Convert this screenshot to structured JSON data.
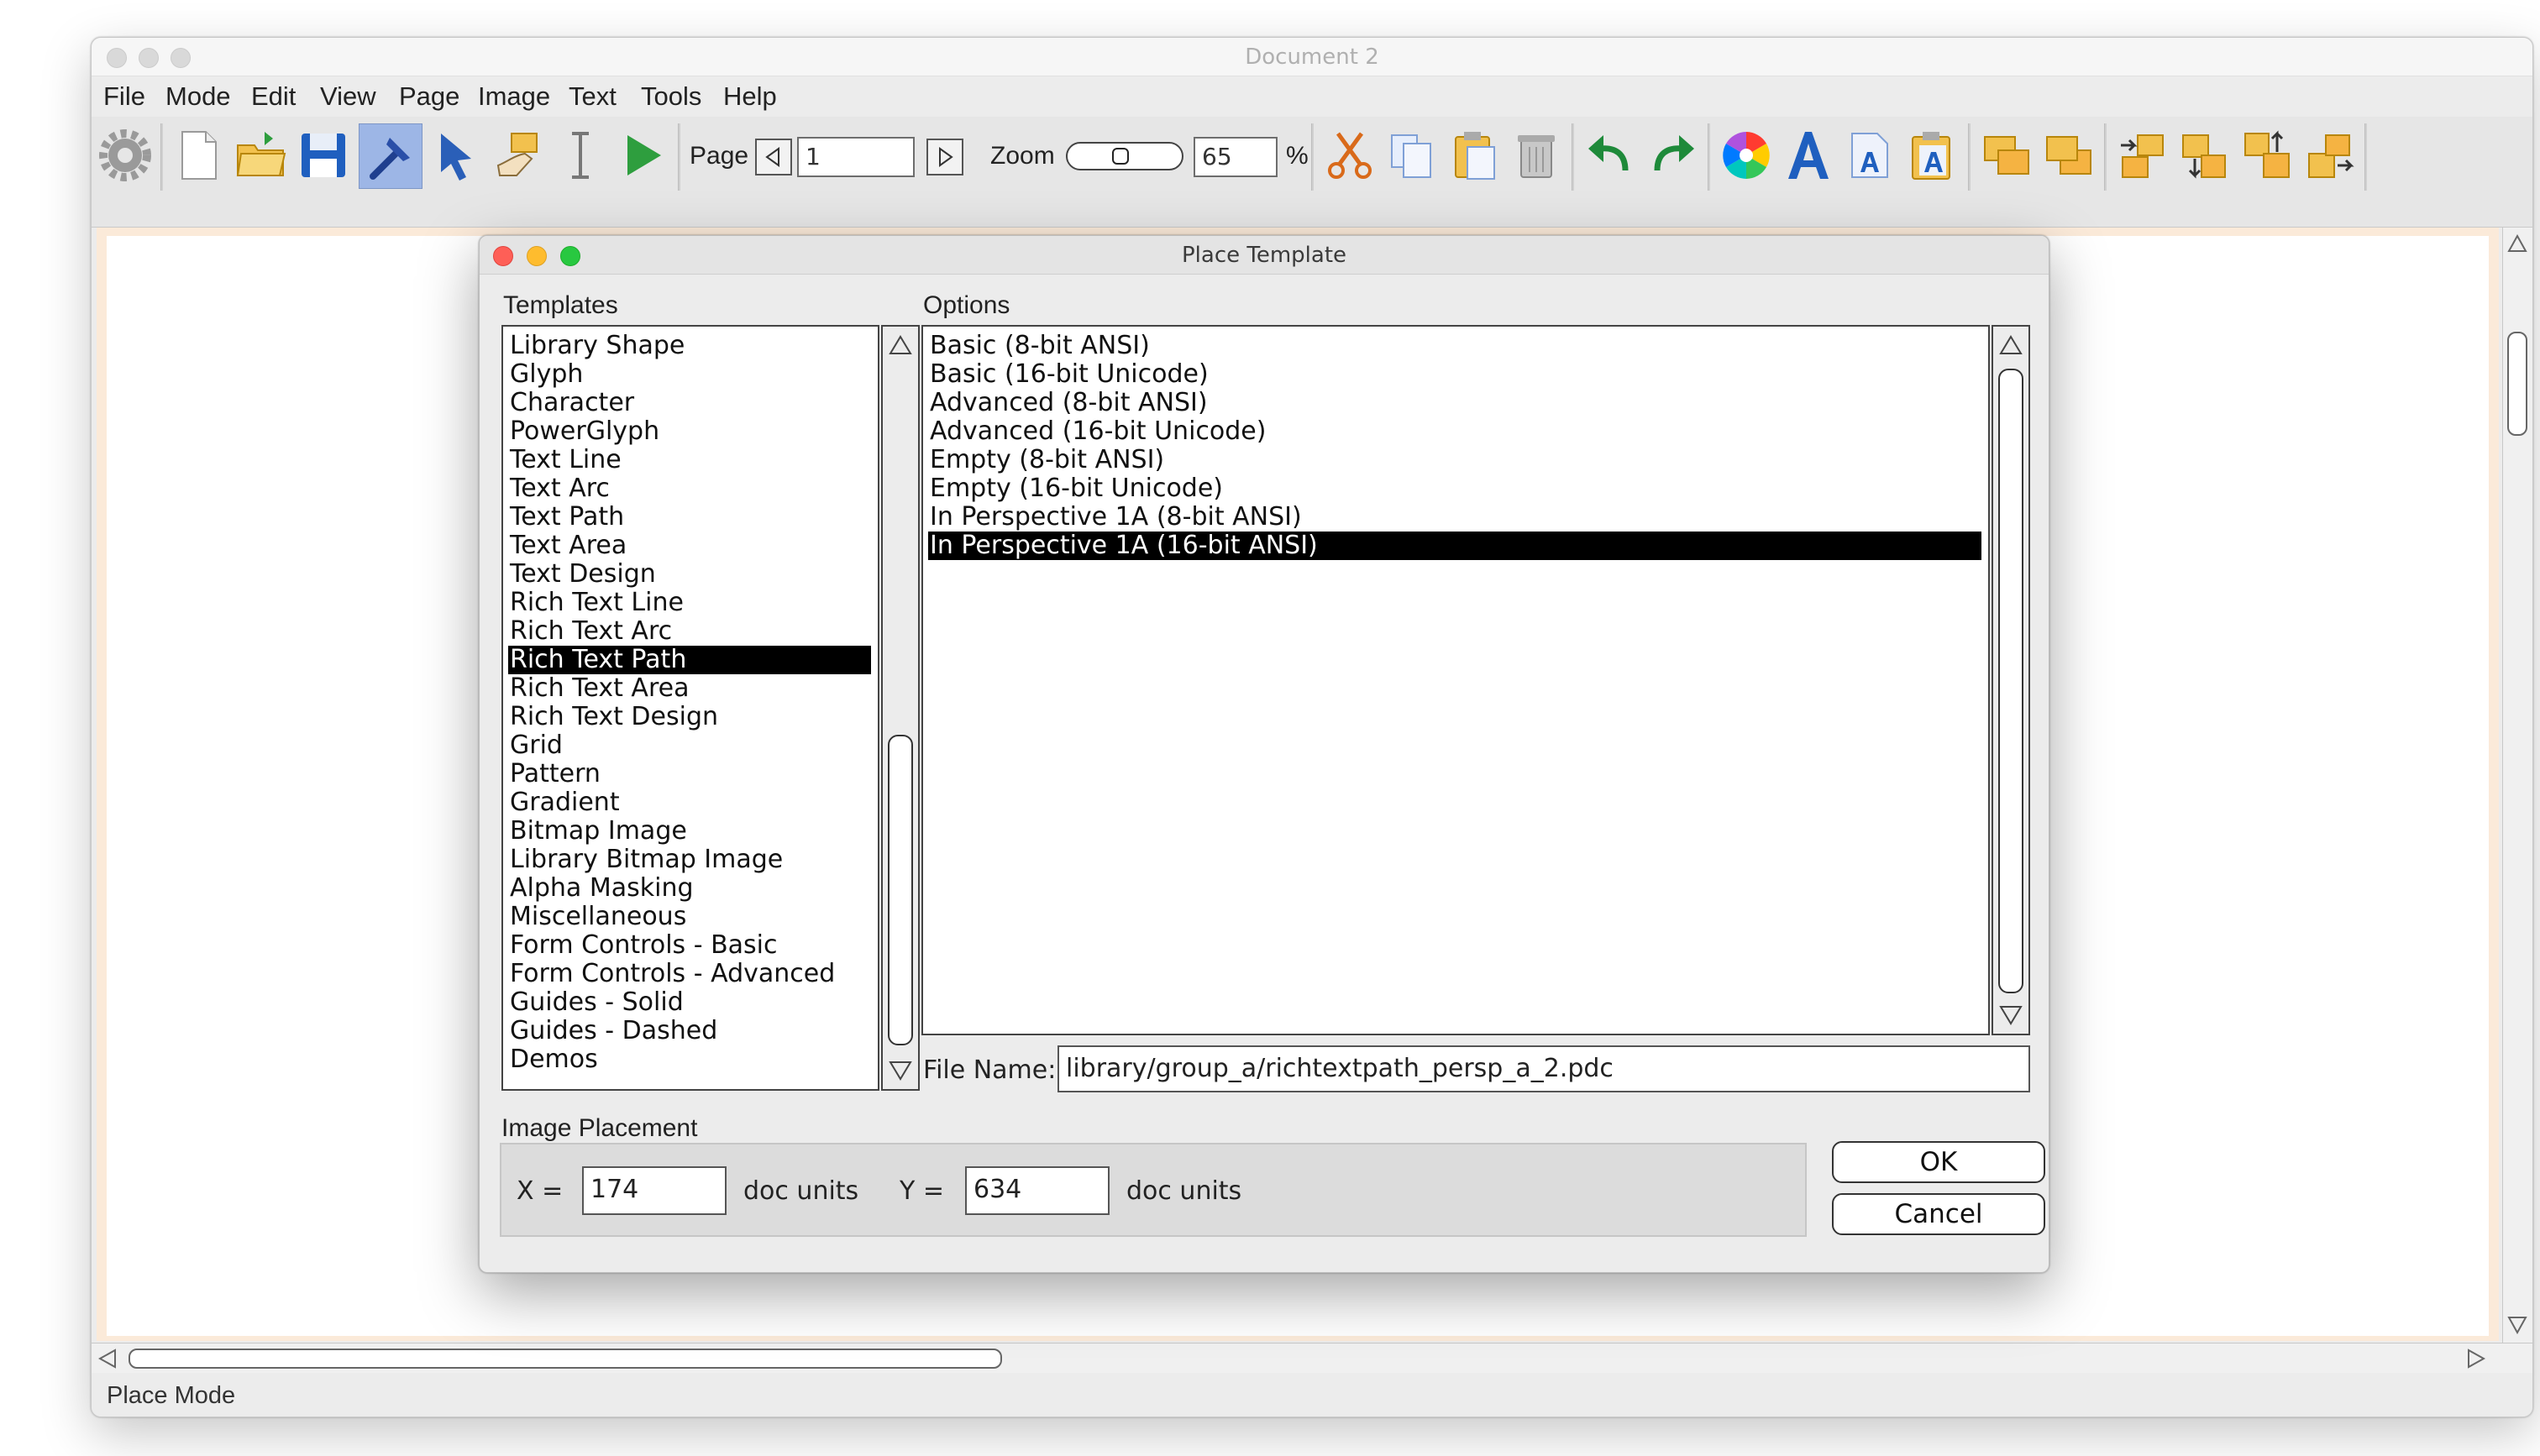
{
  "window": {
    "title": "Document 2"
  },
  "menubar": [
    "File",
    "Mode",
    "Edit",
    "View",
    "Page",
    "Image",
    "Text",
    "Tools",
    "Help"
  ],
  "toolbar": {
    "page_label": "Page",
    "page_value": "1",
    "zoom_label": "Zoom",
    "zoom_value": "65",
    "zoom_unit": "%",
    "zoom_slider_level": 0.45,
    "icons": [
      "settings-gear-icon",
      "new-document-icon",
      "open-folder-icon",
      "save-disk-icon",
      "hammer-tool-icon",
      "select-arrow-icon",
      "place-hand-icon",
      "text-cursor-icon",
      "play-icon",
      "cut-scissors-icon",
      "copy-icon",
      "paste-icon",
      "trash-icon",
      "undo-icon",
      "redo-icon",
      "color-wheel-icon",
      "font-icon",
      "text-document-icon",
      "text-clipboard-icon",
      "bring-forward-icon",
      "send-backward-icon",
      "align-left-icon",
      "align-bottom-icon",
      "align-top-icon",
      "align-right-icon"
    ]
  },
  "status": {
    "text": "Place Mode"
  },
  "dialog": {
    "title": "Place Template",
    "templates_label": "Templates",
    "options_label": "Options",
    "templates": [
      "Library Shape",
      "Glyph",
      "Character",
      "PowerGlyph",
      "Text Line",
      "Text Arc",
      "Text Path",
      "Text Area",
      "Text Design",
      "Rich Text Line",
      "Rich Text Arc",
      "Rich Text Path",
      "Rich Text Area",
      "Rich Text Design",
      "Grid",
      "Pattern",
      "Gradient",
      "Bitmap Image",
      "Library Bitmap Image",
      "Alpha Masking",
      "Miscellaneous",
      "Form Controls - Basic",
      "Form Controls - Advanced",
      "Guides - Solid",
      "Guides - Dashed",
      "Demos"
    ],
    "templates_selected": "Rich Text Path",
    "options": [
      "Basic (8-bit ANSI)",
      "Basic (16-bit Unicode)",
      "Advanced (8-bit ANSI)",
      "Advanced (16-bit Unicode)",
      "Empty (8-bit ANSI)",
      "Empty (16-bit Unicode)",
      "In Perspective 1A (8-bit ANSI)",
      "In Perspective 1A (16-bit ANSI)"
    ],
    "options_selected": "In Perspective 1A (16-bit ANSI)",
    "file_name_label": "File Name:",
    "file_name_value": "library/group_a/richtextpath_persp_a_2.pdc",
    "placement_label": "Image Placement",
    "x_label": "X =",
    "x_value": "174",
    "y_label": "Y =",
    "y_value": "634",
    "units_label": "doc units",
    "ok_label": "OK",
    "cancel_label": "Cancel"
  },
  "colors": {
    "selection": "#000000",
    "canvas_border": "#fbead9",
    "accent_blue": "#1f5fbf",
    "toolbar_active": "#9db6e6"
  }
}
